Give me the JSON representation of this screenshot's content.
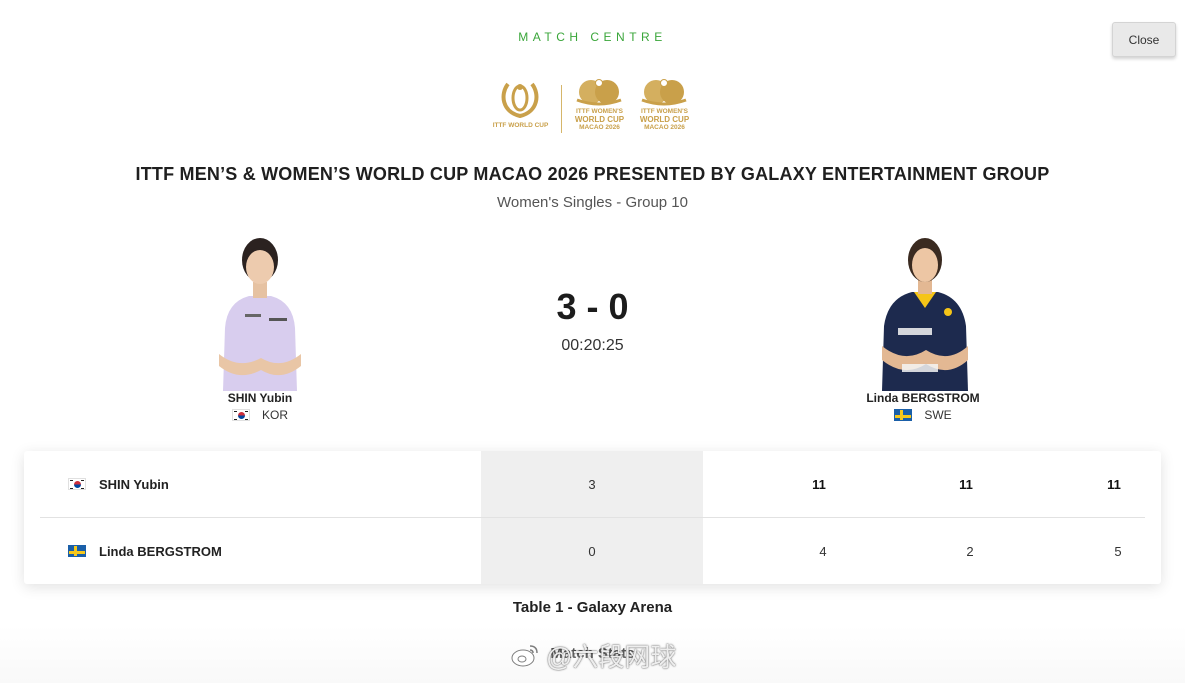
{
  "header": {
    "label": "MATCH CENTRE",
    "close_label": "Close",
    "accent_color": "#3aa63a"
  },
  "logos": {
    "brand_color": "#c9a04a",
    "mens_logo_text": "ITTF WORLD CUP",
    "womens_logo_line1": "ITTF WOMEN'S",
    "womens_logo_line2": "WORLD CUP",
    "womens_logo_line3": "MACAO 2026"
  },
  "event": {
    "title": "ITTF MEN’S & WOMEN’S WORLD CUP MACAO 2026 PRESENTED BY GALAXY ENTERTAINMENT GROUP",
    "subtitle": "Women's Singles - Group 10"
  },
  "match": {
    "score": "3 - 0",
    "duration": "00:20:25",
    "venue": "Table 1 - Galaxy Arena",
    "stats_heading": "Match Stats"
  },
  "players": [
    {
      "name": "SHIN Yubin",
      "country": "KOR",
      "flag": "flag-kor",
      "games_won": "3",
      "game_scores": [
        "11",
        "11",
        "11"
      ]
    },
    {
      "name": "Linda BERGSTROM",
      "country": "SWE",
      "flag": "flag-swe",
      "games_won": "0",
      "game_scores": [
        "4",
        "2",
        "5"
      ]
    }
  ],
  "watermark": {
    "icon": "weibo-icon",
    "text": "@六段网球"
  }
}
